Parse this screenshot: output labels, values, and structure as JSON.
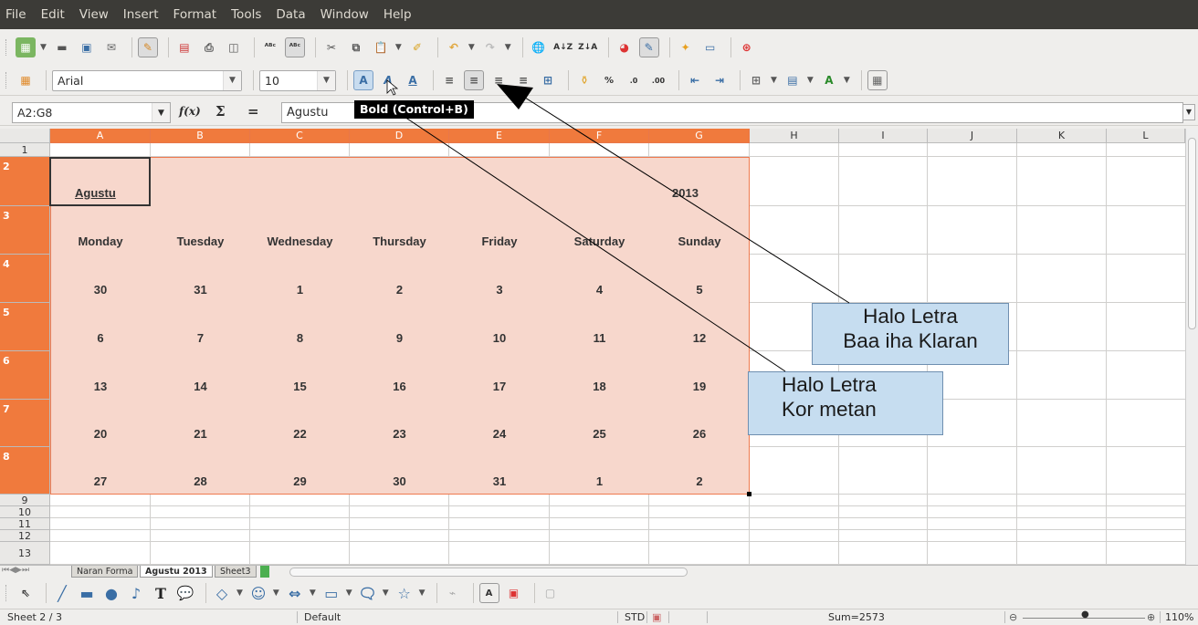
{
  "menu": [
    "File",
    "Edit",
    "View",
    "Insert",
    "Format",
    "Tools",
    "Data",
    "Window",
    "Help"
  ],
  "font": {
    "name": "Arial",
    "size": "10"
  },
  "formula_bar": {
    "name_box": "A2:G8",
    "content": "Agustu",
    "fx": "f(x)",
    "sum": "Σ",
    "equals": "="
  },
  "tooltip": "Bold (Control+B)",
  "columns": [
    "A",
    "B",
    "C",
    "D",
    "E",
    "F",
    "G",
    "H",
    "I",
    "J",
    "K",
    "L"
  ],
  "rows": [
    "1",
    "2",
    "3",
    "4",
    "5",
    "6",
    "7",
    "8",
    "9",
    "10",
    "11",
    "12",
    "13"
  ],
  "calendar": {
    "month": "Agustu",
    "year": "2013",
    "days": [
      "Monday",
      "Tuesday",
      "Wednesday",
      "Thursday",
      "Friday",
      "Saturday",
      "Sunday"
    ],
    "weeks": [
      [
        "30",
        "31",
        "1",
        "2",
        "3",
        "4",
        "5"
      ],
      [
        "6",
        "7",
        "8",
        "9",
        "10",
        "11",
        "12"
      ],
      [
        "13",
        "14",
        "15",
        "16",
        "17",
        "18",
        "19"
      ],
      [
        "20",
        "21",
        "22",
        "23",
        "24",
        "25",
        "26"
      ],
      [
        "27",
        "28",
        "29",
        "30",
        "31",
        "1",
        "2"
      ]
    ]
  },
  "callouts": [
    {
      "line1": "Halo Letra",
      "line2": "Baa iha Klaran"
    },
    {
      "line1": "Halo Letra",
      "line2": "Kor metan"
    }
  ],
  "sheet_tabs": [
    "Naran Forma",
    "Agustu 2013",
    "Sheet3"
  ],
  "status": {
    "sheet": "Sheet 2 / 3",
    "style": "Default",
    "mode": "STD",
    "sum": "Sum=2573",
    "zoom": "110%"
  },
  "colors": {
    "selection": "#f7d7cc",
    "header_selected": "#f07a3d",
    "menubar": "#3c3b37",
    "callout": "#c6ddf0"
  }
}
